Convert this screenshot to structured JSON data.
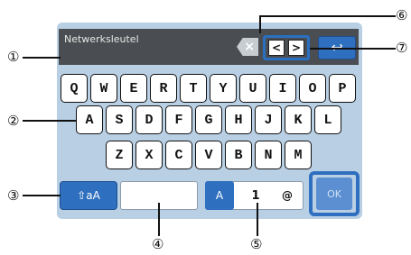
{
  "text_field": {
    "value": "Netwerksleutel"
  },
  "backspace_glyph": "×",
  "cursor_left_glyph": "<",
  "cursor_right_glyph": ">",
  "enter_glyph": "↩",
  "keyboard": {
    "row1": [
      "Q",
      "W",
      "E",
      "R",
      "T",
      "Y",
      "U",
      "I",
      "O",
      "P"
    ],
    "row2": [
      "A",
      "S",
      "D",
      "F",
      "G",
      "H",
      "J",
      "K",
      "L"
    ],
    "row3": [
      "Z",
      "X",
      "C",
      "V",
      "B",
      "N",
      "M"
    ]
  },
  "shift_label": "⇧aA",
  "mode": {
    "alpha": "A",
    "numeric": "1",
    "symbol": "@"
  },
  "ok_label": "OK",
  "callouts": [
    "①",
    "②",
    "③",
    "④",
    "⑤",
    "⑥",
    "⑦"
  ],
  "colors": {
    "accent": "#2f6fbf",
    "panel": "#b9cfe4",
    "field": "#4a4d51"
  }
}
